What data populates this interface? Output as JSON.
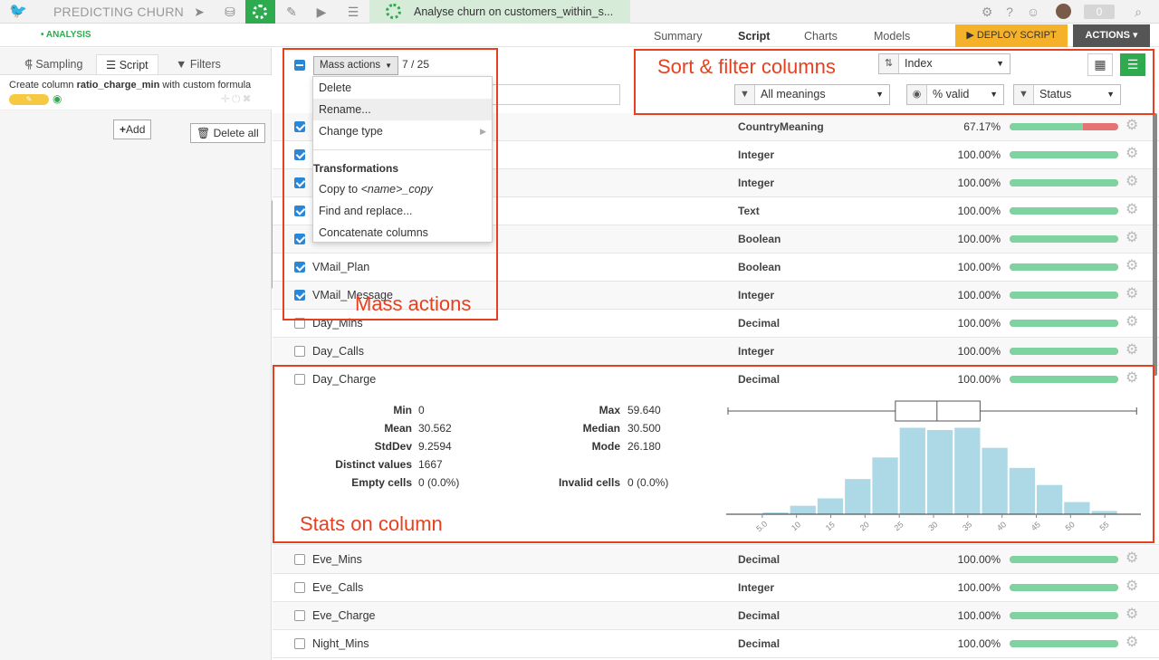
{
  "topbar": {
    "project": "PREDICTING CHURN",
    "breadcrumb": "Analyse churn on customers_within_s...",
    "notifications": "0"
  },
  "subbar": {
    "analysis_label": "• ANALYSIS",
    "tabs": [
      "Summary",
      "Script",
      "Charts",
      "Models"
    ],
    "active_tab": "Script",
    "deploy": "▶ DEPLOY SCRIPT",
    "actions": "ACTIONS ▾"
  },
  "left_panel": {
    "tabs": [
      "Sampling",
      "Script",
      "Filters"
    ],
    "step_prefix": "Create column ",
    "step_column": "ratio_charge_min",
    "step_suffix": " with custom formula",
    "add": "Add",
    "delete_all": "Delete all"
  },
  "mass": {
    "button": "Mass actions",
    "count": "7 / 25",
    "menu": {
      "delete": "Delete",
      "rename": "Rename...",
      "change_type": "Change type",
      "transformations": "Transformations",
      "copy_prefix": "Copy to ",
      "copy_name": "<name>_copy",
      "find_replace": "Find and replace...",
      "concatenate": "Concatenate columns"
    }
  },
  "sort_filter": {
    "sort": "Index",
    "meanings": "All meanings",
    "valid": "% valid",
    "status": "Status"
  },
  "columns": [
    {
      "name": "",
      "meaning": "CountryMeaning",
      "pct": "67.17%",
      "valid": 0.6717,
      "checked": true
    },
    {
      "name": "",
      "meaning": "Integer",
      "pct": "100.00%",
      "valid": 1,
      "checked": true
    },
    {
      "name": "",
      "meaning": "Integer",
      "pct": "100.00%",
      "valid": 1,
      "checked": true
    },
    {
      "name": "",
      "meaning": "Text",
      "pct": "100.00%",
      "valid": 1,
      "checked": true
    },
    {
      "name": "",
      "meaning": "Boolean",
      "pct": "100.00%",
      "valid": 1,
      "checked": true
    },
    {
      "name": "VMail_Plan",
      "meaning": "Boolean",
      "pct": "100.00%",
      "valid": 1,
      "checked": true
    },
    {
      "name": "VMail_Message",
      "meaning": "Integer",
      "pct": "100.00%",
      "valid": 1,
      "checked": true
    },
    {
      "name": "Day_Mins",
      "meaning": "Decimal",
      "pct": "100.00%",
      "valid": 1,
      "checked": false
    },
    {
      "name": "Day_Calls",
      "meaning": "Integer",
      "pct": "100.00%",
      "valid": 1,
      "checked": false
    },
    {
      "name": "Day_Charge",
      "meaning": "Decimal",
      "pct": "100.00%",
      "valid": 1,
      "checked": false
    },
    {
      "name": "Eve_Mins",
      "meaning": "Decimal",
      "pct": "100.00%",
      "valid": 1,
      "checked": false
    },
    {
      "name": "Eve_Calls",
      "meaning": "Integer",
      "pct": "100.00%",
      "valid": 1,
      "checked": false
    },
    {
      "name": "Eve_Charge",
      "meaning": "Decimal",
      "pct": "100.00%",
      "valid": 1,
      "checked": false
    },
    {
      "name": "Night_Mins",
      "meaning": "Decimal",
      "pct": "100.00%",
      "valid": 1,
      "checked": false
    }
  ],
  "stats": {
    "min_label": "Min",
    "min": "0",
    "max_label": "Max",
    "max": "59.640",
    "mean_label": "Mean",
    "mean": "30.562",
    "median_label": "Median",
    "median": "30.500",
    "stddev_label": "StdDev",
    "stddev": "9.2594",
    "mode_label": "Mode",
    "mode": "26.180",
    "distinct_label": "Distinct values",
    "distinct": "1667",
    "empty_label": "Empty cells",
    "empty": "0 (0.0%)",
    "invalid_label": "Invalid cells",
    "invalid": "0 (0.0%)"
  },
  "chart_data": {
    "type": "bar",
    "bins_start": [
      0,
      5,
      7.5,
      10,
      12.5,
      15,
      17.5,
      20,
      22.5,
      25,
      27.5,
      30,
      32.5,
      35,
      37.5,
      40,
      42.5,
      45,
      47.5,
      50,
      52.5,
      55
    ],
    "bins": [
      [
        0,
        2
      ],
      [
        2,
        4
      ],
      [
        4,
        6
      ],
      [
        6,
        8
      ],
      [
        8,
        10
      ],
      [
        10,
        12
      ],
      [
        12,
        14
      ]
    ],
    "hist_x": [
      3,
      7,
      11,
      15,
      19,
      23,
      27,
      31,
      35,
      39,
      43,
      47,
      51,
      55
    ],
    "hist_y": [
      1,
      3,
      12,
      22,
      48,
      77,
      117,
      114,
      117,
      90,
      63,
      40,
      17,
      5
    ],
    "ticks": [
      "5.0",
      "10",
      "15",
      "20",
      "25",
      "30",
      "35",
      "40",
      "45",
      "50",
      "55"
    ],
    "tick_values": [
      5,
      10,
      15,
      20,
      25,
      30,
      35,
      40,
      45,
      50,
      55
    ],
    "boxplot": {
      "min": 0,
      "q1": 24.43,
      "median": 30.5,
      "q3": 36.79,
      "max": 59.64
    },
    "xlim": [
      0,
      60
    ],
    "color": "#add8e6"
  },
  "annotations": {
    "sort_filter": "Sort & filter columns",
    "mass_actions": "Mass actions",
    "stats": "Stats on column"
  }
}
